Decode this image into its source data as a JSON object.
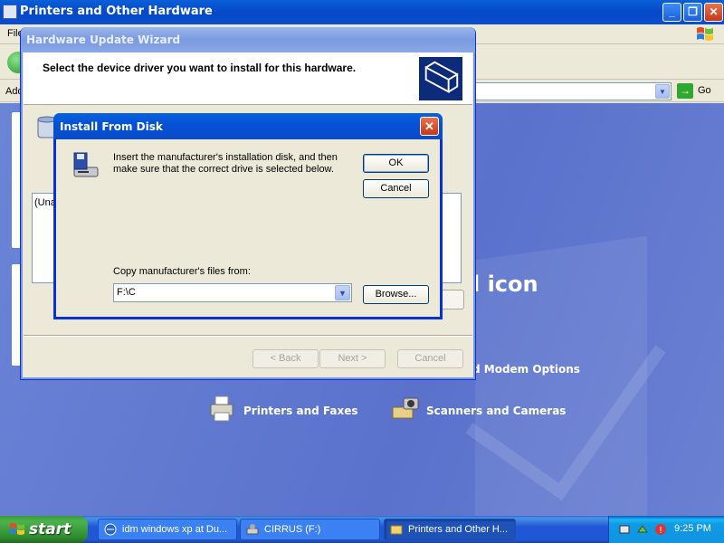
{
  "explorer": {
    "title": "Printers and Other Hardware",
    "menu_first": "File",
    "address_label": "Address",
    "go_label": "Go",
    "heading_partial": "l icon",
    "task_modem": "d Modem Options",
    "task_printers": "Printers and Faxes",
    "task_scanners": "Scanners and Cameras"
  },
  "wizard": {
    "title": "Hardware Update Wizard",
    "header_text": "Select the device driver you want to install for this hardware.",
    "list_item": "(Una",
    "back_label": "< Back",
    "next_label": "Next >",
    "cancel_label": "Cancel"
  },
  "dialog": {
    "title": "Install From Disk",
    "message": "Insert the manufacturer's installation disk, and then make sure that the correct drive is selected below.",
    "ok_label": "OK",
    "cancel_label": "Cancel",
    "copy_label": "Copy manufacturer's files from:",
    "path_value": "F:\\C",
    "browse_label": "Browse..."
  },
  "taskbar": {
    "start_label": "start",
    "buttons": [
      {
        "label": "idm windows xp at Du...",
        "icon": "browser-icon"
      },
      {
        "label": "CIRRUS (F:)",
        "icon": "drive-icon"
      },
      {
        "label": "Printers and Other H...",
        "icon": "folder-icon"
      }
    ],
    "clock": "9:25 PM"
  },
  "colors": {
    "xp_blue": "#0a4fd0",
    "start_green": "#3c9a3c",
    "content_blue": "#5a72cc"
  }
}
